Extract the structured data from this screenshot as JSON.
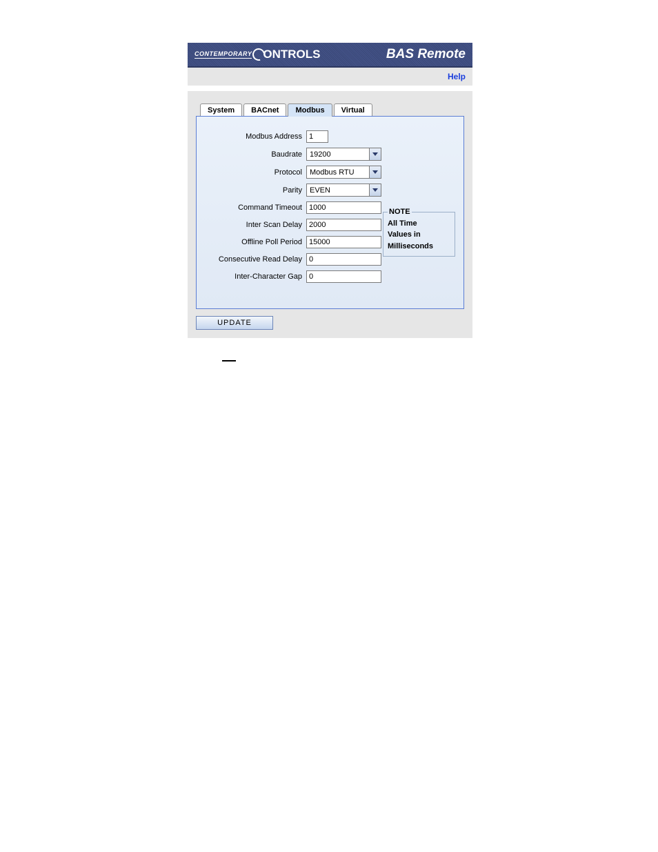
{
  "header": {
    "logo_contemporary": "CONTEMPORARY",
    "logo_controls": "ONTROLS",
    "title": "BAS Remote",
    "help": "Help"
  },
  "tabs": [
    {
      "label": "System"
    },
    {
      "label": "BACnet"
    },
    {
      "label": "Modbus"
    },
    {
      "label": "Virtual"
    }
  ],
  "form": {
    "modbus_address": {
      "label": "Modbus Address",
      "value": "1"
    },
    "baudrate": {
      "label": "Baudrate",
      "value": "19200"
    },
    "protocol": {
      "label": "Protocol",
      "value": "Modbus RTU"
    },
    "parity": {
      "label": "Parity",
      "value": "EVEN"
    },
    "command_timeout": {
      "label": "Command Timeout",
      "value": "1000"
    },
    "inter_scan_delay": {
      "label": "Inter Scan Delay",
      "value": "2000"
    },
    "offline_poll_period": {
      "label": "Offline Poll Period",
      "value": "15000"
    },
    "consecutive_read_delay": {
      "label": "Consecutive Read Delay",
      "value": "0"
    },
    "inter_character_gap": {
      "label": "Inter-Character Gap",
      "value": "0"
    }
  },
  "note": {
    "legend": "NOTE",
    "line1": "All Time",
    "line2": "Values in",
    "line3": "Milliseconds"
  },
  "buttons": {
    "update": "UPDATE"
  }
}
